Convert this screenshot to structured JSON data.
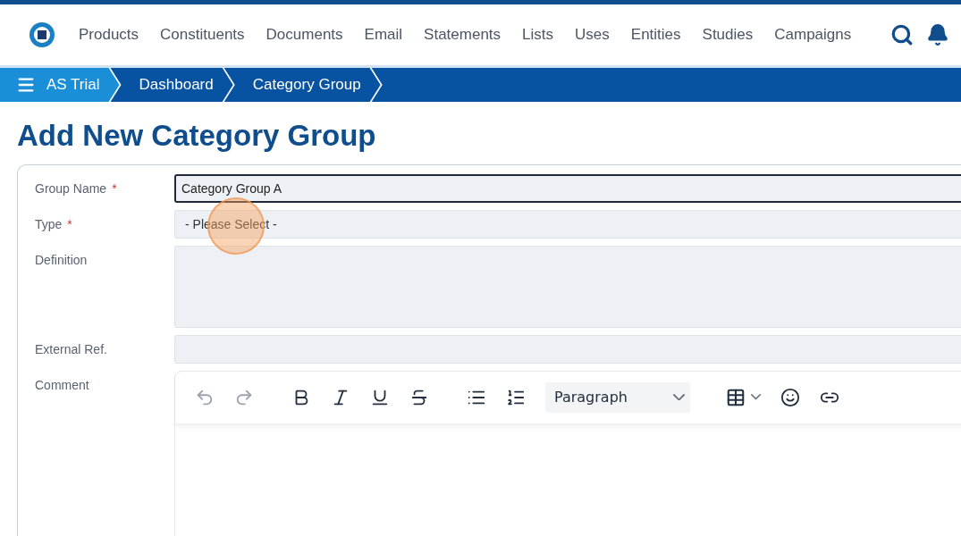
{
  "nav": {
    "items": [
      "Products",
      "Constituents",
      "Documents",
      "Email",
      "Statements",
      "Lists",
      "Uses",
      "Entities",
      "Studies",
      "Campaigns"
    ]
  },
  "breadcrumbs": [
    {
      "label": "AS Trial",
      "kind": "home"
    },
    {
      "label": "Dashboard",
      "kind": "crumb"
    },
    {
      "label": "Category Group",
      "kind": "crumb"
    }
  ],
  "title": "Add New Category Group",
  "fields": [
    {
      "label": "Group Name",
      "required_mark": "*",
      "kind": "text",
      "value": "Category Group A",
      "focused": true
    },
    {
      "label": "Type",
      "required_mark": "*",
      "kind": "select",
      "value": "- Please Select -",
      "focused": false
    },
    {
      "label": "Definition",
      "kind": "textarea",
      "focused": false
    },
    {
      "label": "External Ref.",
      "kind": "text",
      "focused": false
    },
    {
      "label": "Comment",
      "kind": "editor",
      "focused": false
    }
  ],
  "editor": {
    "tools": [
      {
        "kind": "undo",
        "disabled": true
      },
      {
        "kind": "redo",
        "disabled": true
      },
      {
        "kind": "gap"
      },
      {
        "kind": "bold",
        "disabled": false
      },
      {
        "kind": "italic",
        "disabled": false
      },
      {
        "kind": "underline",
        "disabled": false
      },
      {
        "kind": "strike",
        "disabled": false
      },
      {
        "kind": "gap"
      },
      {
        "kind": "bullets",
        "disabled": false
      },
      {
        "kind": "numbers",
        "disabled": false
      },
      {
        "kind": "block",
        "value": "Paragraph"
      },
      {
        "kind": "table",
        "disabled": false
      },
      {
        "kind": "emoji",
        "disabled": false
      },
      {
        "kind": "link",
        "disabled": false
      }
    ]
  }
}
